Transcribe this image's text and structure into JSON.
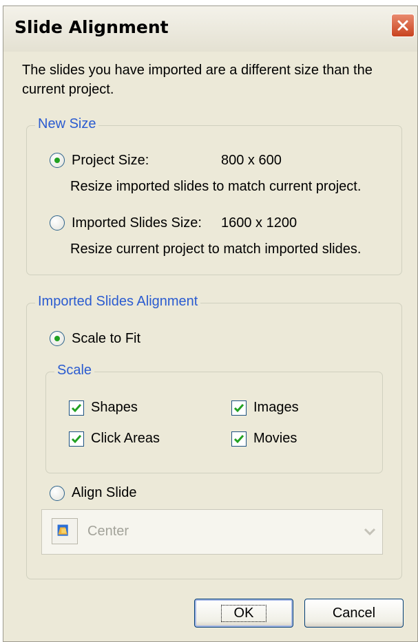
{
  "dialog": {
    "title": "Slide Alignment",
    "description": "The slides you have imported are a different size than the current project."
  },
  "new_size": {
    "legend": "New Size",
    "project": {
      "label": "Project Size:",
      "value": "800 x 600",
      "description": "Resize imported slides to match current project.",
      "selected": true
    },
    "imported": {
      "label": "Imported Slides Size:",
      "value": "1600 x 1200",
      "description": "Resize current project to match imported slides.",
      "selected": false
    }
  },
  "alignment": {
    "legend": "Imported Slides Alignment",
    "scale_to_fit": {
      "label": "Scale to Fit",
      "selected": true
    },
    "scale": {
      "legend": "Scale",
      "shapes": {
        "label": "Shapes",
        "checked": true
      },
      "images": {
        "label": "Images",
        "checked": true
      },
      "click_areas": {
        "label": "Click Areas",
        "checked": true
      },
      "movies": {
        "label": "Movies",
        "checked": true
      }
    },
    "align_slide": {
      "label": "Align Slide",
      "selected": false
    },
    "align_select": {
      "value": "Center",
      "icon": "align-center-icon",
      "disabled": true
    }
  },
  "buttons": {
    "ok": "OK",
    "cancel": "Cancel"
  },
  "colors": {
    "legend_text": "#2a5bd0",
    "radio_dot": "#21a121",
    "checkmark": "#21a121",
    "close_button": "#c8431f"
  }
}
